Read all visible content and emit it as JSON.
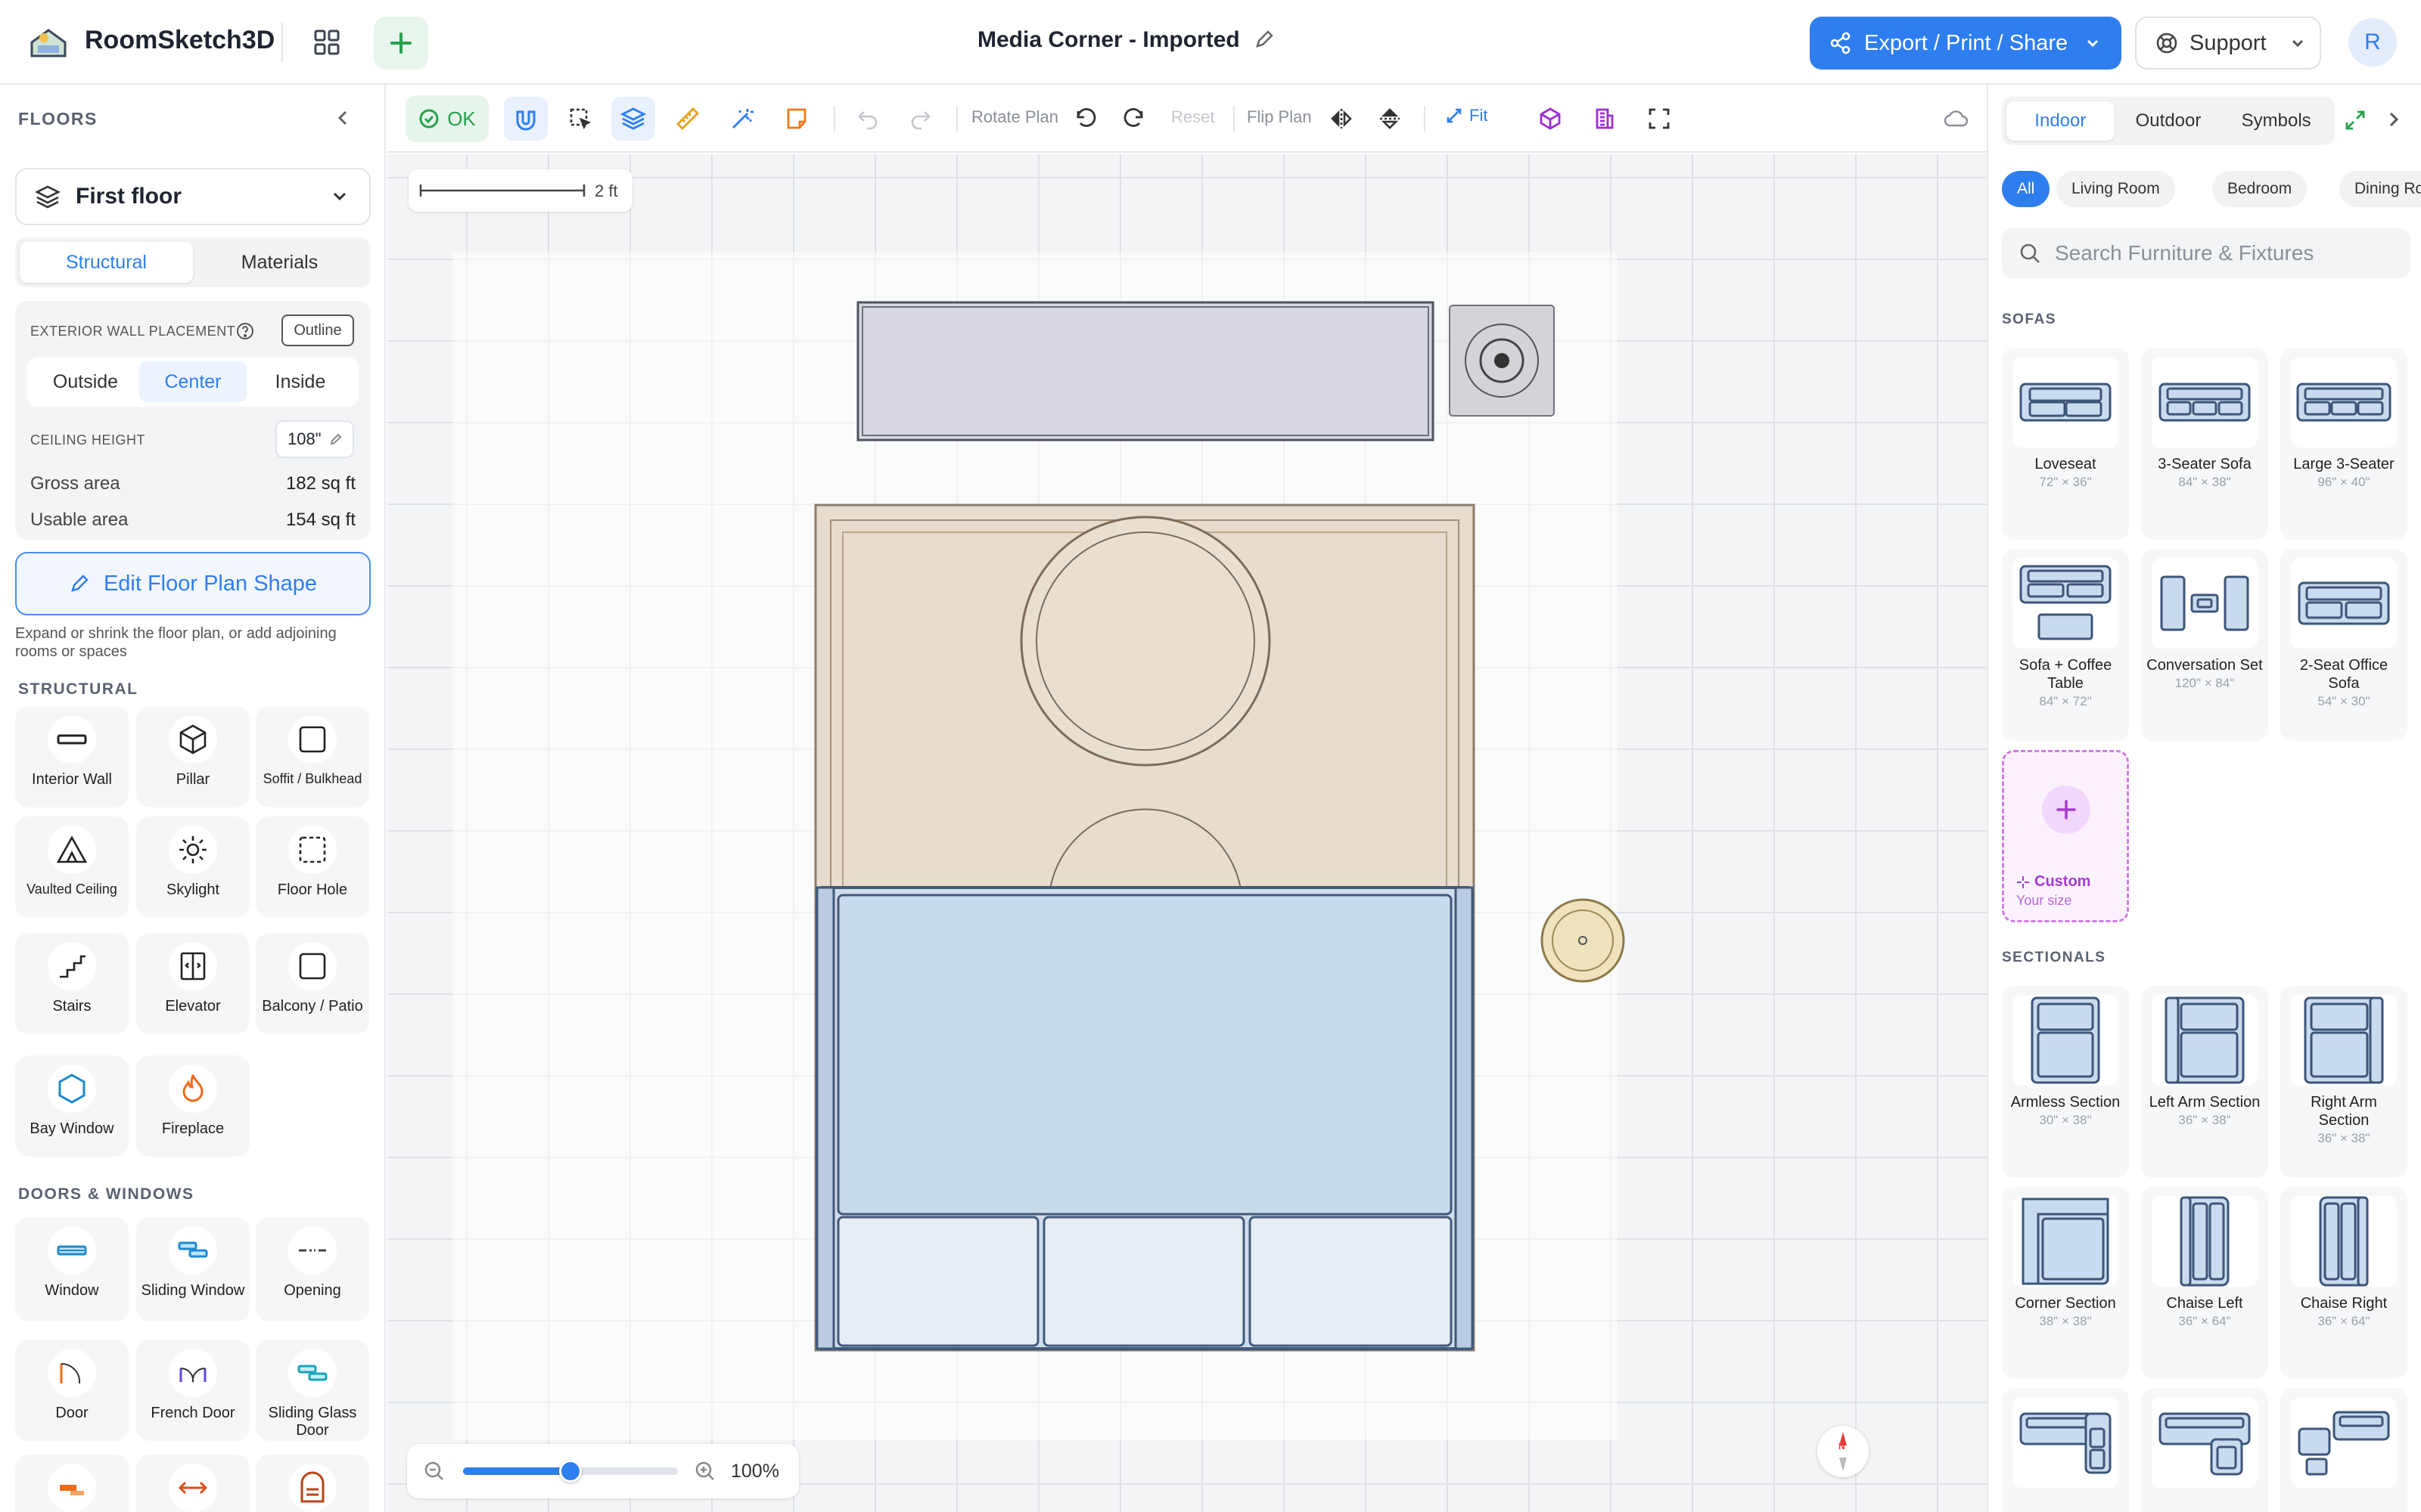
{
  "app": {
    "name": "RoomSketch3D",
    "project_title": "Media Corner - Imported",
    "export_label": "Export / Print / Share",
    "support_label": "Support",
    "avatar_initial": "R",
    "accent": "#2f7ef0"
  },
  "floors": {
    "heading": "FLOORS",
    "selected_floor": "First floor",
    "tabs": [
      "Structural",
      "Materials"
    ],
    "active_tab": "Structural",
    "wall_placement_label": "EXTERIOR WALL PLACEMENT",
    "outline_label": "Outline",
    "placement_options": [
      "Outside",
      "Center",
      "Inside"
    ],
    "active_placement": "Center",
    "ceiling_label": "CEILING HEIGHT",
    "ceiling_value": "108\"",
    "gross_label": "Gross area",
    "gross_value": "182 sq ft",
    "usable_label": "Usable area",
    "usable_value": "154 sq ft",
    "edit_label": "Edit Floor Plan Shape",
    "edit_hint": "Expand or shrink the floor plan, or add adjoining rooms or spaces"
  },
  "structural": {
    "heading": "STRUCTURAL",
    "items": [
      {
        "label": "Interior Wall",
        "icon": "interior-wall-icon"
      },
      {
        "label": "Pillar",
        "icon": "pillar-icon"
      },
      {
        "label": "Soffit / Bulkhead",
        "icon": "soffit-icon"
      },
      {
        "label": "Vaulted Ceiling",
        "icon": "vaulted-ceiling-icon"
      },
      {
        "label": "Skylight",
        "icon": "skylight-icon"
      },
      {
        "label": "Floor Hole",
        "icon": "floor-hole-icon"
      },
      {
        "label": "Stairs",
        "icon": "stairs-icon"
      },
      {
        "label": "Elevator",
        "icon": "elevator-icon"
      },
      {
        "label": "Balcony / Patio",
        "icon": "balcony-icon"
      },
      {
        "label": "Bay Window",
        "icon": "bay-window-icon"
      },
      {
        "label": "Fireplace",
        "icon": "fireplace-icon"
      }
    ]
  },
  "doors_windows": {
    "heading": "DOORS & WINDOWS",
    "items": [
      {
        "label": "Window",
        "icon": "window-icon"
      },
      {
        "label": "Sliding Window",
        "icon": "sliding-window-icon"
      },
      {
        "label": "Opening",
        "icon": "opening-icon"
      },
      {
        "label": "Door",
        "icon": "door-icon"
      },
      {
        "label": "French Door",
        "icon": "french-door-icon"
      },
      {
        "label": "Sliding Glass Door",
        "icon": "sliding-glass-door-icon"
      }
    ]
  },
  "toolbar": {
    "status": "OK",
    "rotate_label": "Rotate Plan",
    "reset_label": "Reset",
    "flip_label": "Flip Plan",
    "fit_label": "Fit"
  },
  "canvas": {
    "scale_label": "2 ft",
    "zoom_label": "100%",
    "zoom_level": 0.5,
    "compass": "N"
  },
  "catalog": {
    "tabs": [
      "Indoor",
      "Outdoor",
      "Symbols"
    ],
    "active_tab": "Indoor",
    "chips": [
      "All",
      "Living Room",
      "Bedroom",
      "Dining Room"
    ],
    "active_chip": "All",
    "search_placeholder": "Search Furniture & Fixtures",
    "sofas_heading": "SOFAS",
    "sofas": [
      {
        "name": "Loveseat",
        "dims": "72\" × 36\""
      },
      {
        "name": "3-Seater Sofa",
        "dims": "84\" × 38\""
      },
      {
        "name": "Large 3-Seater",
        "dims": "96\" × 40\""
      },
      {
        "name": "Sofa + Coffee Table",
        "dims": "84\" × 72\""
      },
      {
        "name": "Conversation Set",
        "dims": "120\" × 84\""
      },
      {
        "name": "2-Seat Office Sofa",
        "dims": "54\" × 30\""
      }
    ],
    "custom": {
      "name": "Custom",
      "sub": "Your size"
    },
    "sectionals_heading": "SECTIONALS",
    "sectionals": [
      {
        "name": "Armless Section",
        "dims": "30\" × 38\""
      },
      {
        "name": "Left Arm Section",
        "dims": "36\" × 38\""
      },
      {
        "name": "Right Arm Section",
        "dims": "36\" × 38\""
      },
      {
        "name": "Corner Section",
        "dims": "38\" × 38\""
      },
      {
        "name": "Chaise Left",
        "dims": "36\" × 64\""
      },
      {
        "name": "Chaise Right",
        "dims": "36\" × 64\""
      }
    ]
  }
}
